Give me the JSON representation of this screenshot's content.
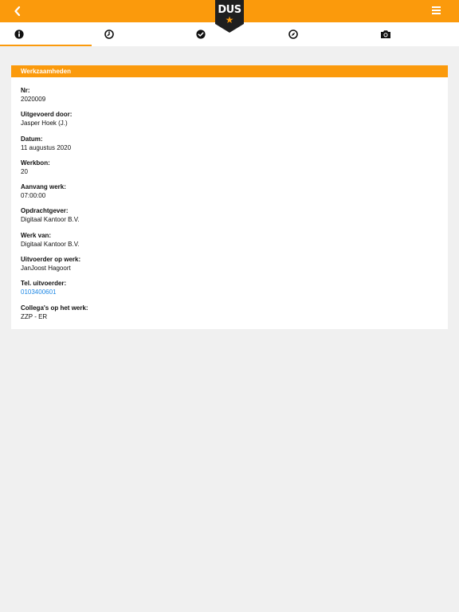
{
  "header": {
    "logo_text": "DUS",
    "back_icon": "chevron-left-icon",
    "menu_icon": "hamburger-menu-icon"
  },
  "tabs": [
    {
      "icon": "info-icon",
      "active": true
    },
    {
      "icon": "clock-icon",
      "active": false
    },
    {
      "icon": "check-circle-icon",
      "active": false
    },
    {
      "icon": "compass-icon",
      "active": false
    },
    {
      "icon": "camera-icon",
      "active": false
    }
  ],
  "card": {
    "title": "Werkzaamheden",
    "fields": [
      {
        "label": "Nr:",
        "value": "2020009"
      },
      {
        "label": "Uitgevoerd door:",
        "value": "Jasper Hoek (J.)"
      },
      {
        "label": "Datum:",
        "value": "11 augustus 2020"
      },
      {
        "label": "Werkbon:",
        "value": "20"
      },
      {
        "label": "Aanvang werk:",
        "value": "07:00:00"
      },
      {
        "label": "Opdrachtgever:",
        "value": "Digitaal Kantoor B.V."
      },
      {
        "label": "Werk van:",
        "value": "Digitaal Kantoor B.V."
      },
      {
        "label": "Uitvoerder op werk:",
        "value": "JanJoost Hagoort"
      },
      {
        "label": "Tel. uitvoerder:",
        "value": "0103400601"
      },
      {
        "label": "Collega's op het werk:",
        "value": "ZZP - ER"
      }
    ]
  },
  "colors": {
    "accent": "#fb9a0c",
    "link": "#1e88e5",
    "background": "#f0f0f0"
  }
}
